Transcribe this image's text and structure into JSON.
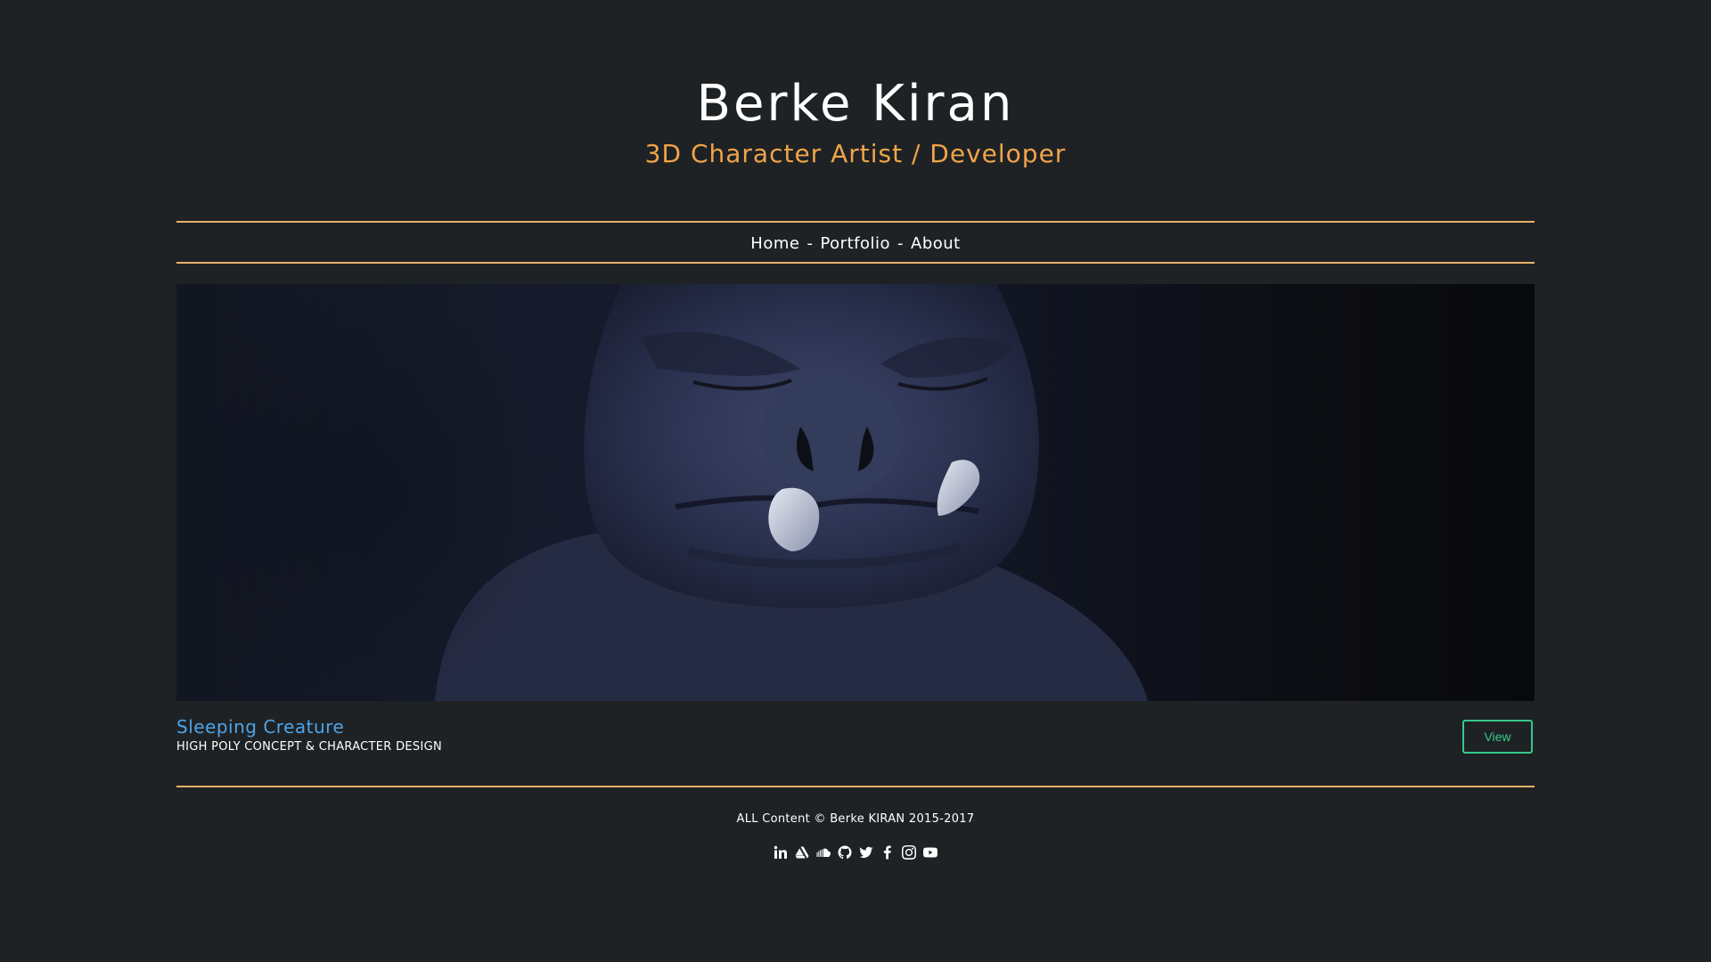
{
  "header": {
    "title": "Berke Kiran",
    "subtitle": "3D Character Artist / Developer"
  },
  "nav": {
    "items": [
      {
        "label": "Home"
      },
      {
        "label": "Portfolio"
      },
      {
        "label": "About"
      }
    ],
    "separator": "-"
  },
  "hero": {
    "title": "Sleeping Creature",
    "subtitle": "HIGH POLY CONCEPT & CHARACTER DESIGN",
    "view_label": "View"
  },
  "footer": {
    "text": "ALL Content © Berke KIRAN 2015-2017",
    "social_icons": [
      "linkedin-icon",
      "artstation-icon",
      "soundcloud-icon",
      "github-icon",
      "twitter-icon",
      "facebook-icon",
      "instagram-icon",
      "youtube-icon"
    ]
  },
  "colors": {
    "background": "#1f2224",
    "accent": "#f0a44a",
    "rule": "#e8b06c",
    "link": "#4ea3e6",
    "button": "#36c98c"
  }
}
